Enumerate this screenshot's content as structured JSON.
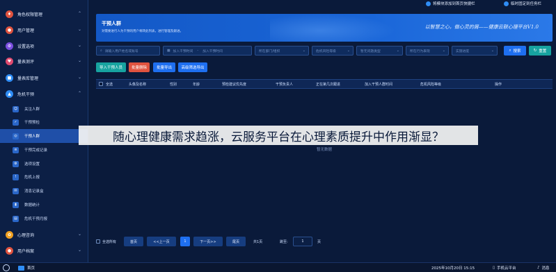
{
  "top_actions": {
    "add_to_home": "将模块添加到首页快捷栏",
    "pin_to_left": "临时固定到任务栏"
  },
  "sidebar": {
    "items": [
      {
        "label": "角色权限管理",
        "icon": "role-icon",
        "color": "#e0533f"
      },
      {
        "label": "用户管理",
        "icon": "user-icon",
        "color": "#e0533f"
      },
      {
        "label": "设置选项",
        "icon": "settings-icon",
        "color": "#7a4fe0"
      },
      {
        "label": "量表测评",
        "icon": "scale-icon",
        "color": "#e04a6f"
      },
      {
        "label": "量表库管理",
        "icon": "library-icon",
        "color": "#2f8df5"
      },
      {
        "label": "危机干预",
        "icon": "crisis-icon",
        "color": "#2f8df5"
      }
    ],
    "sub_items": [
      {
        "label": "关注人群",
        "icon": "people-icon"
      },
      {
        "label": "干预预检",
        "icon": "check-icon"
      },
      {
        "label": "干预人群",
        "icon": "target-icon"
      },
      {
        "label": "干预完成记录",
        "icon": "record-icon"
      },
      {
        "label": "选项设置",
        "icon": "option-icon"
      },
      {
        "label": "危机上报",
        "icon": "report-icon"
      },
      {
        "label": "消息记录盒",
        "icon": "message-icon"
      },
      {
        "label": "数据统计",
        "icon": "stats-icon"
      },
      {
        "label": "危机干预月报",
        "icon": "monthly-icon"
      }
    ],
    "bottom_items": [
      {
        "label": "心理咨询",
        "icon": "consult-icon",
        "color": "#f0a020"
      },
      {
        "label": "用户档案",
        "icon": "profile-icon",
        "color": "#e0533f"
      }
    ]
  },
  "banner": {
    "title": "干预人群",
    "description": "对需要进行人为干预的用户将转此列表，进行管理及跟进。",
    "slogan": "以智慧之心，做心灵的屑——健康云联心理平台V1.0"
  },
  "filters": {
    "search_placeholder": "请输入用户姓名或账号",
    "date_start_placeholder": "加入干预时间",
    "date_sep": "-",
    "date_end_placeholder": "加入干预时间",
    "dept_placeholder": "所在部门/组织",
    "level_placeholder": "危机风险等级",
    "problem_placeholder": "暂无问题类型",
    "person_placeholder": "所在行为表现",
    "status_placeholder": "实施进度",
    "search_label": "搜索",
    "reset_label": "重置"
  },
  "actions": {
    "import": "导入干预人员",
    "batch_delete": "批量删除",
    "batch_export": "批量导出",
    "advanced_export": "高级筛选导出"
  },
  "table": {
    "headers": [
      "全选",
      "头像及名称",
      "性别",
      "年龄",
      "预检建议优先度",
      "干预负责人",
      "正在第几次跟进",
      "加入干预人群时间",
      "危机风险等级",
      "操作"
    ],
    "empty_text": "暂无数据"
  },
  "pager": {
    "select_all": "全选所有",
    "first": "首页",
    "prev": "<<上一页",
    "current": "1",
    "next": "下一页>>",
    "last": "尾页",
    "total": "共1页",
    "jump_label": "跳至:",
    "jump_value": "1",
    "page_unit": "页"
  },
  "overlay": {
    "headline": "随心理健康需求趋涨，云服务平台在心理素质提升中作用渐显？"
  },
  "taskbar": {
    "home": "首页",
    "datetime": "2025年10月20日 15:15",
    "mobile": "手机云平台",
    "messages": "消息"
  }
}
